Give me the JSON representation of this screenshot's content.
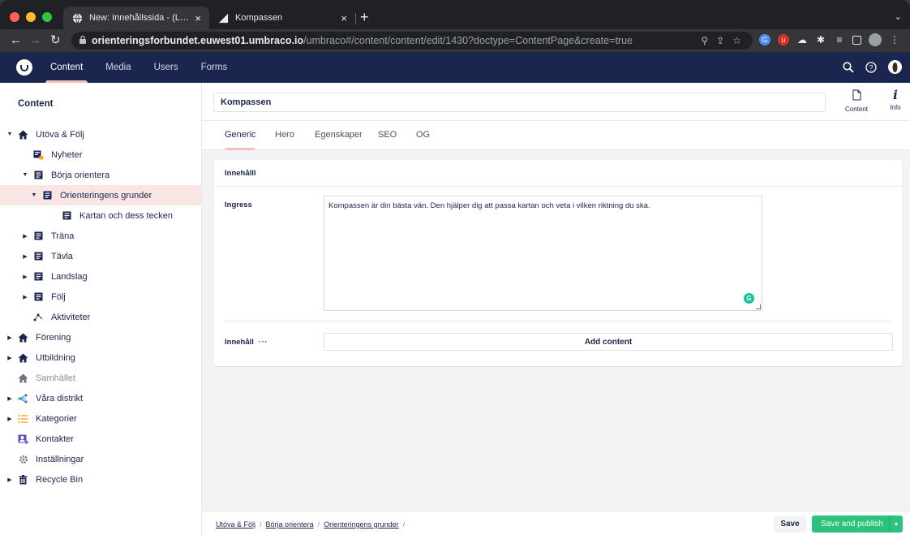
{
  "browser": {
    "tabs": [
      {
        "title": "New: Innehållssida - (Live) Con",
        "active": true
      },
      {
        "title": "Kompassen",
        "active": false
      }
    ],
    "close_glyph": "×",
    "newtab_glyph": "+",
    "tab_dropdown_glyph": "⌄",
    "address": {
      "host": "orienteringsforbundet.euwest01.umbraco.io",
      "path": "/umbraco#/content/content/edit/1430?doctype=ContentPage&create=true"
    }
  },
  "topbar": {
    "nav": [
      "Content",
      "Media",
      "Users",
      "Forms"
    ],
    "active": "Content"
  },
  "sidebar": {
    "heading": "Content",
    "tree": [
      {
        "label": "Utöva & Följ",
        "level": 0,
        "caret": "down",
        "icon": "home-icon"
      },
      {
        "label": "Nyheter",
        "level": 1,
        "caret": "",
        "icon": "news-icon"
      },
      {
        "label": "Börja orientera",
        "level": 1,
        "caret": "down",
        "icon": "page-icon"
      },
      {
        "label": "Orienteringens grunder",
        "level": 2,
        "caret": "down",
        "icon": "page-icon",
        "selected": true
      },
      {
        "label": "Kartan och dess tecken",
        "level": 3,
        "caret": "",
        "icon": "page-icon"
      },
      {
        "label": "Träna",
        "level": 1,
        "caret": "right",
        "icon": "page-icon"
      },
      {
        "label": "Tävla",
        "level": 1,
        "caret": "right",
        "icon": "page-icon"
      },
      {
        "label": "Landslag",
        "level": 1,
        "caret": "right",
        "icon": "page-icon"
      },
      {
        "label": "Följ",
        "level": 1,
        "caret": "right",
        "icon": "page-icon"
      },
      {
        "label": "Aktiviteter",
        "level": 1,
        "caret": "",
        "icon": "activities-icon"
      },
      {
        "label": "Förening",
        "level": 0,
        "caret": "right",
        "icon": "home-icon"
      },
      {
        "label": "Utbildning",
        "level": 0,
        "caret": "right",
        "icon": "home-icon"
      },
      {
        "label": "Samhället",
        "level": 0,
        "caret": "",
        "icon": "home-muted-icon",
        "muted": true
      },
      {
        "label": "Våra distrikt",
        "level": 0,
        "caret": "right",
        "icon": "network-icon"
      },
      {
        "label": "Kategorier",
        "level": 0,
        "caret": "right",
        "icon": "list-icon"
      },
      {
        "label": "Kontakter",
        "level": 0,
        "caret": "",
        "icon": "contacts-icon"
      },
      {
        "label": "Inställningar",
        "level": 0,
        "caret": "",
        "icon": "settings-icon"
      },
      {
        "label": "Recycle Bin",
        "level": 0,
        "caret": "right",
        "icon": "trash-icon"
      }
    ]
  },
  "editor": {
    "name_value": "Kompassen",
    "apps": [
      {
        "label": "Content",
        "icon": "document-icon"
      },
      {
        "label": "Info",
        "icon": "info-icon"
      }
    ],
    "tabs": [
      "Generic",
      "Hero",
      "Egenskaper",
      "SEO",
      "OG"
    ],
    "active_tab": "Generic",
    "group_title": "Innehålll",
    "ingress_label": "Ingress",
    "ingress_value": "Kompassen är din bästa vän. Den hjälper dig att passa kartan och veta i vilken riktning du ska.",
    "content_label": "Innehåll",
    "content_menu": "···",
    "add_content_label": "Add content"
  },
  "footer": {
    "breadcrumb": [
      "Utöva & Följ",
      "Börja orientera",
      "Orienteringens grunder"
    ],
    "separator": "/",
    "save_label": "Save",
    "publish_label": "Save and publish"
  },
  "colors": {
    "topbar": "#1b264f",
    "accent": "#f5c1bc",
    "selected_row": "#f9e6e4",
    "publish": "#2bc37c"
  }
}
